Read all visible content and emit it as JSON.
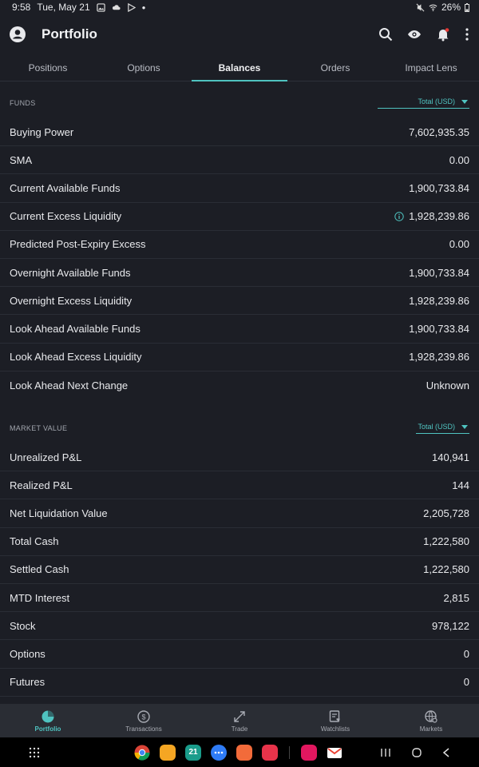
{
  "status_bar": {
    "time": "9:58",
    "date": "Tue, May 21",
    "battery": "26%"
  },
  "header": {
    "title": "Portfolio"
  },
  "tabs": [
    "Positions",
    "Options",
    "Balances",
    "Orders",
    "Impact Lens"
  ],
  "funds": {
    "label": "FUNDS",
    "dropdown": "Total (USD)",
    "rows": [
      {
        "name": "Buying Power",
        "value": "7,602,935.35"
      },
      {
        "name": "SMA",
        "value": "0.00"
      },
      {
        "name": "Current Available Funds",
        "value": "1,900,733.84"
      },
      {
        "name": "Current Excess Liquidity",
        "value": "1,928,239.86"
      },
      {
        "name": "Predicted Post-Expiry Excess",
        "value": "0.00"
      },
      {
        "name": "Overnight Available Funds",
        "value": "1,900,733.84"
      },
      {
        "name": "Overnight Excess Liquidity",
        "value": "1,928,239.86"
      },
      {
        "name": "Look Ahead Available Funds",
        "value": "1,900,733.84"
      },
      {
        "name": "Look Ahead Excess Liquidity",
        "value": "1,928,239.86"
      },
      {
        "name": "Look Ahead Next Change",
        "value": "Unknown"
      }
    ]
  },
  "market_value": {
    "label": "MARKET VALUE",
    "dropdown": "Total (USD)",
    "rows": [
      {
        "name": "Unrealized P&L",
        "value": "140,941"
      },
      {
        "name": "Realized P&L",
        "value": "144"
      },
      {
        "name": "Net Liquidation Value",
        "value": "2,205,728"
      },
      {
        "name": "Total Cash",
        "value": "1,222,580"
      },
      {
        "name": "Settled Cash",
        "value": "1,222,580"
      },
      {
        "name": "MTD Interest",
        "value": "2,815"
      },
      {
        "name": "Stock",
        "value": "978,122"
      },
      {
        "name": "Options",
        "value": "0"
      },
      {
        "name": "Futures",
        "value": "0"
      }
    ]
  },
  "bottom_nav": [
    "Portfolio",
    "Transactions",
    "Trade",
    "Watchlists",
    "Markets"
  ],
  "taskbar_date": "21",
  "colors": {
    "accent": "#4fc3c0",
    "background": "#1c1e25",
    "nav_background": "#2a2d34"
  }
}
